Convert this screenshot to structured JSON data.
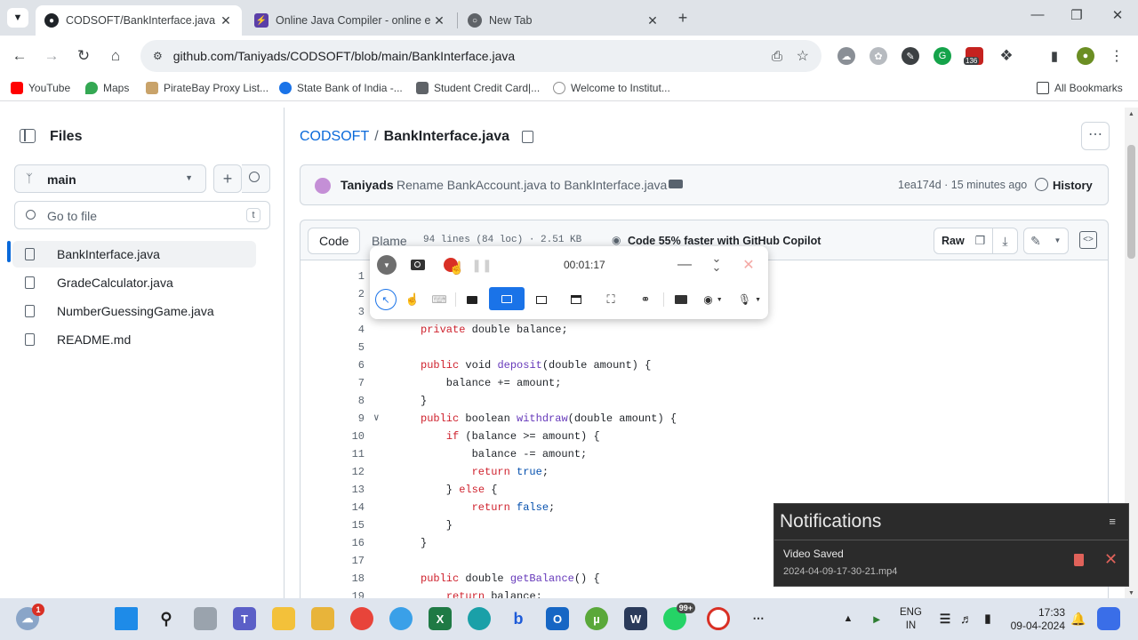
{
  "tabs": [
    {
      "title": "CODSOFT/BankInterface.java at",
      "active": true
    },
    {
      "title": "Online Java Compiler - online e",
      "active": false
    },
    {
      "title": "New Tab",
      "active": false
    }
  ],
  "omnibox": {
    "url": "github.com/Taniyads/CODSOFT/blob/main/BankInterface.java"
  },
  "extensions": {
    "badge": "136"
  },
  "bookmarks": [
    {
      "label": "YouTube",
      "color": "#ff0000"
    },
    {
      "label": "Maps",
      "color": "#34a853"
    },
    {
      "label": "PirateBay Proxy List...",
      "color": "#c9a36a"
    },
    {
      "label": "State Bank of India -...",
      "color": "#1a73e8"
    },
    {
      "label": "Student Credit Card|...",
      "color": "#5f6368"
    },
    {
      "label": "Welcome to Institut...",
      "color": "#8e8e8e"
    }
  ],
  "all_bookmarks": "All Bookmarks",
  "sidebar": {
    "title": "Files",
    "branch": "main",
    "goto_placeholder": "Go to file",
    "goto_shortcut": "t",
    "files": [
      {
        "name": "BankInterface.java",
        "selected": true
      },
      {
        "name": "GradeCalculator.java",
        "selected": false
      },
      {
        "name": "NumberGuessingGame.java",
        "selected": false
      },
      {
        "name": "README.md",
        "selected": false
      }
    ]
  },
  "breadcrumb": {
    "repo": "CODSOFT",
    "sep": "/",
    "file": "BankInterface.java"
  },
  "commit": {
    "author": "Taniyads",
    "message": "Rename BankAccount.java to BankInterface.java",
    "meta": "1ea174d · 15 minutes ago",
    "history": "History"
  },
  "codebar": {
    "code_tab": "Code",
    "blame_tab": "Blame",
    "stats": "94 lines (84 loc) · 2.51 KB",
    "copilot": "Code 55% faster with GitHub Copilot",
    "raw": "Raw"
  },
  "code_lines": [
    {
      "n": "1",
      "html": ""
    },
    {
      "n": "2",
      "html": ""
    },
    {
      "n": "3",
      "html": "",
      "fold": true
    },
    {
      "n": "4",
      "html": "<span class='kw'>private</span> double balance;"
    },
    {
      "n": "5",
      "html": ""
    },
    {
      "n": "6",
      "html": "<span class='kw'>public</span> void <span class='fn'>deposit</span>(double amount) {"
    },
    {
      "n": "7",
      "html": "    balance += amount;"
    },
    {
      "n": "8",
      "html": "}"
    },
    {
      "n": "9",
      "html": "<span class='kw'>public</span> boolean <span class='fn'>withdraw</span>(double amount) {",
      "fold": true
    },
    {
      "n": "10",
      "html": "    <span class='kw'>if</span> (balance >= amount) {"
    },
    {
      "n": "11",
      "html": "        balance -= amount;"
    },
    {
      "n": "12",
      "html": "        <span class='kw'>return</span> <span class='bl'>true</span>;"
    },
    {
      "n": "13",
      "html": "    } <span class='kw'>else</span> {"
    },
    {
      "n": "14",
      "html": "        <span class='kw'>return</span> <span class='bl'>false</span>;"
    },
    {
      "n": "15",
      "html": "    }"
    },
    {
      "n": "16",
      "html": "}"
    },
    {
      "n": "17",
      "html": ""
    },
    {
      "n": "18",
      "html": "<span class='kw'>public</span> double <span class='fn'>getBalance</span>() {"
    },
    {
      "n": "19",
      "html": "    <span class='kw'>return</span> balance;"
    }
  ],
  "recorder": {
    "timer": "00:01:17"
  },
  "notifications": {
    "title": "Notifications",
    "item_title": "Video Saved",
    "item_file": "2024-04-09-17-30-21.mp4"
  },
  "taskbar": {
    "weather_badge": "1",
    "whatsapp_badge": "99+",
    "lang_line1": "ENG",
    "lang_line2": "IN",
    "time": "17:33",
    "date": "09-04-2024"
  },
  "colors": {
    "github_blue": "#0969da",
    "record_red": "#d93025",
    "recorder_active": "#1a73e8"
  }
}
